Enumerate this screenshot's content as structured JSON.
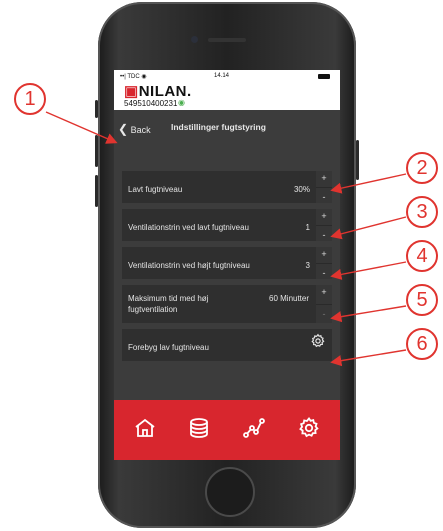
{
  "status_bar": {
    "carrier": "TDC",
    "time": "14.14"
  },
  "brand": {
    "logo": "NILAN.",
    "serial": "549510400231"
  },
  "nav": {
    "back_label": "Back",
    "title": "Indstillinger fugtstyring"
  },
  "settings": [
    {
      "label": "Lavt fugtniveau",
      "value": "30%"
    },
    {
      "label": "Ventilationstrin ved lavt fugtniveau",
      "value": "1"
    },
    {
      "label": "Ventilationstrin ved højt fugtniveau",
      "value": "3"
    },
    {
      "label": "Maksimum tid med høj fugtventilation",
      "value": "60 Minutter"
    },
    {
      "label": "Forebyg lav fugtniveau",
      "value": ""
    }
  ],
  "stepper": {
    "plus": "+",
    "minus": "-"
  },
  "tabbar": {
    "icons": [
      "home-icon",
      "layers-icon",
      "graph-icon",
      "gear-icon"
    ]
  },
  "callouts": [
    "1",
    "2",
    "3",
    "4",
    "5",
    "6"
  ],
  "colors": {
    "accent": "#d8262e",
    "callout": "#e0342f",
    "screen_bg": "#3c3c3c"
  }
}
